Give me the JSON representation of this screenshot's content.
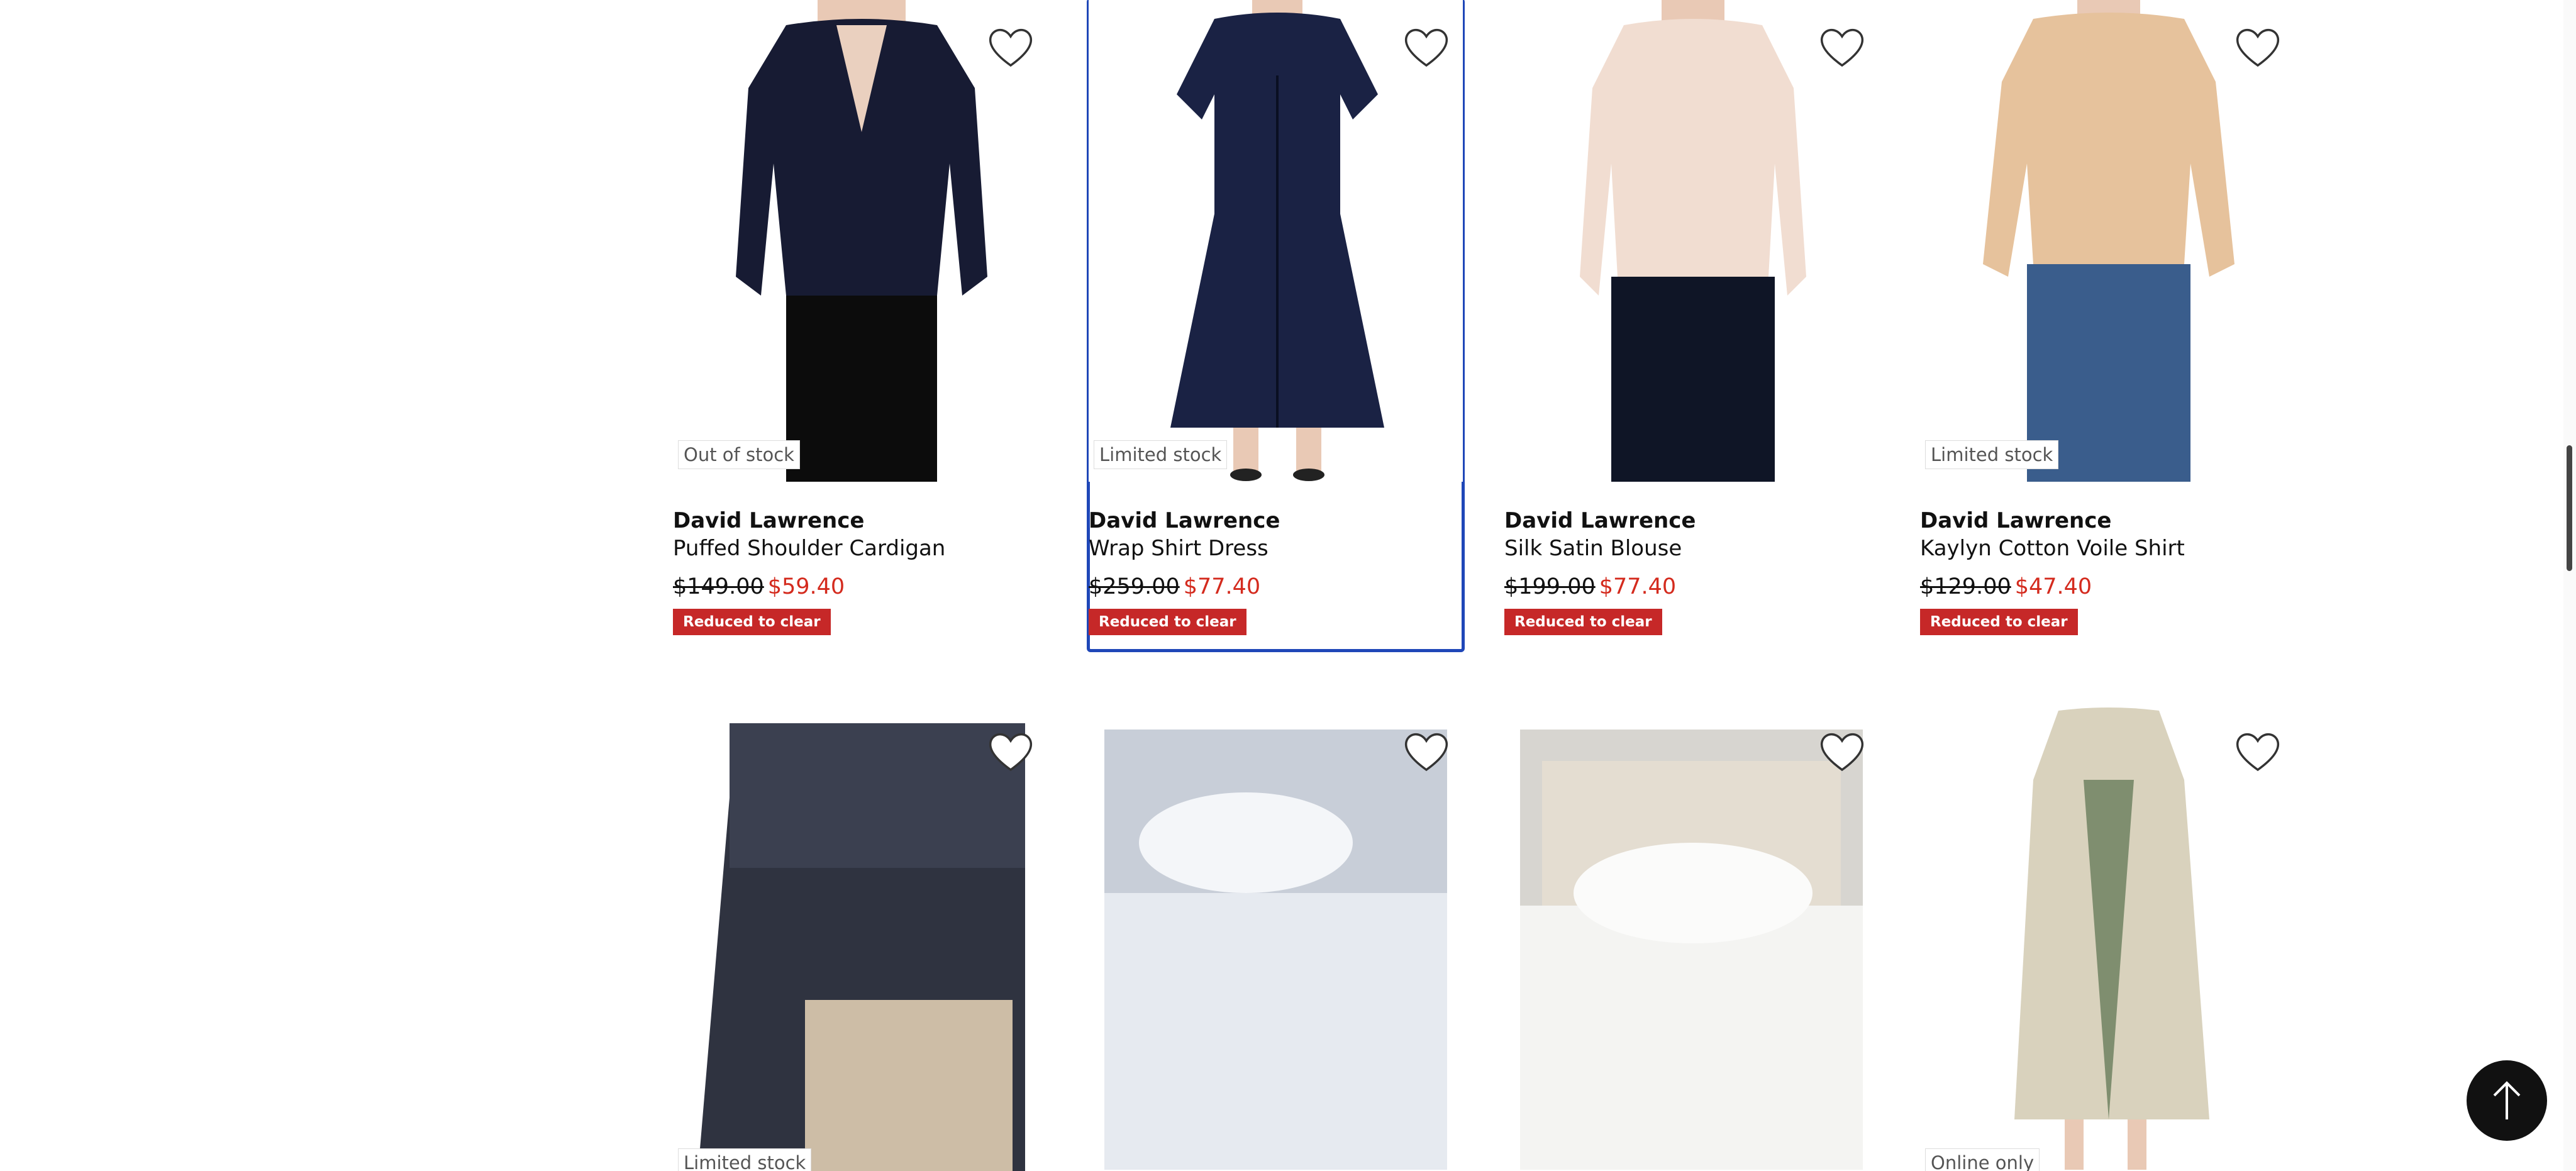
{
  "products_row1": [
    {
      "brand": "David Lawrence",
      "name": "Puffed Shoulder Cardigan",
      "was": "$149.00",
      "now": "$59.40",
      "badge": "Reduced to clear",
      "stock": "Out of stock"
    },
    {
      "brand": "David Lawrence",
      "name": "Wrap Shirt Dress",
      "was": "$259.00",
      "now": "$77.40",
      "badge": "Reduced to clear",
      "stock": "Limited stock"
    },
    {
      "brand": "David Lawrence",
      "name": "Silk Satin Blouse",
      "was": "$199.00",
      "now": "$77.40",
      "badge": "Reduced to clear",
      "stock": ""
    },
    {
      "brand": "David Lawrence",
      "name": "Kaylyn Cotton Voile Shirt",
      "was": "$129.00",
      "now": "$47.40",
      "badge": "Reduced to clear",
      "stock": "Limited stock"
    }
  ],
  "products_row2": [
    {
      "stock": "Limited stock"
    },
    {
      "stock": ""
    },
    {
      "stock": ""
    },
    {
      "stock": "Online only"
    }
  ],
  "icons": {
    "favorite": "heart-outline-icon",
    "back_to_top": "arrow-up-icon"
  },
  "colors": {
    "sale_price": "#d42b1e",
    "badge": "#c62828",
    "focus_outline": "#1f47b8",
    "back_to_top_bg": "#111111"
  }
}
